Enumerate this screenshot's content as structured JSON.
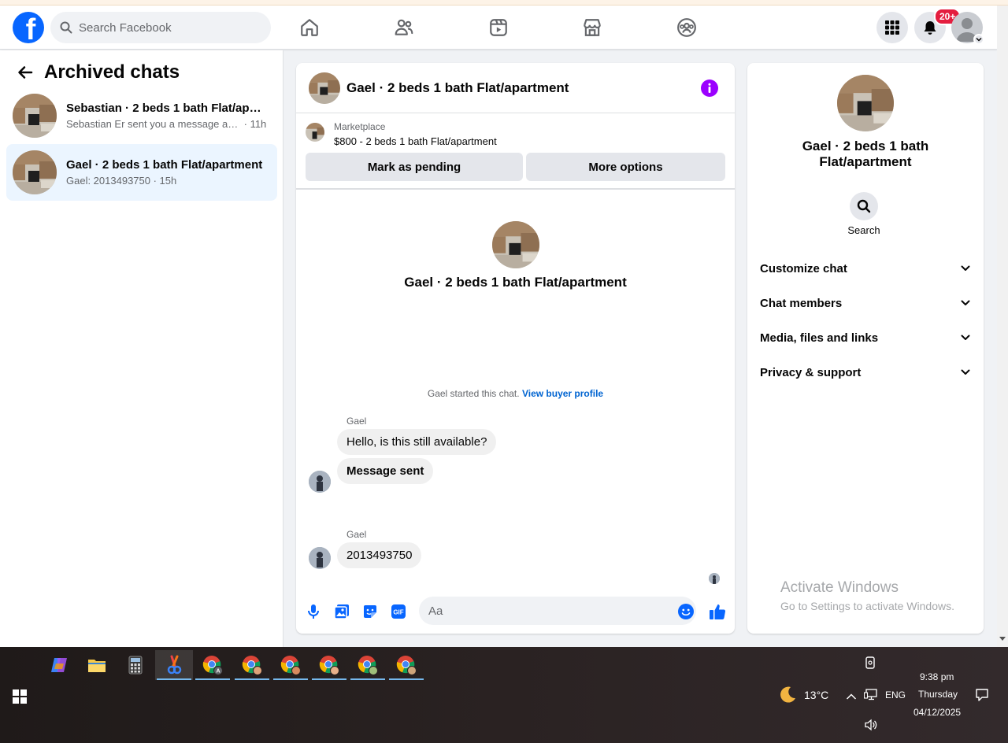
{
  "nav": {
    "search_placeholder": "Search Facebook",
    "notification_badge": "20+"
  },
  "sidebar": {
    "title": "Archived chats",
    "chats": [
      {
        "title": "Sebastian · 2 beds 1 bath Flat/apartment",
        "snippet": "Sebastian Er sent you a message abo...",
        "time": "11h"
      },
      {
        "title": "Gael · 2 beds 1 bath Flat/apartment",
        "snippet": "Gael: 2013493750",
        "time": "15h"
      }
    ]
  },
  "conversation": {
    "title": "Gael · 2 beds 1 bath Flat/apartment",
    "marketplace_label": "Marketplace",
    "listing": "$800 - 2 beds 1 bath Flat/apartment",
    "mark_pending": "Mark as pending",
    "more_options": "More options",
    "intro_title": "Gael · 2 beds 1 bath Flat/apartment",
    "started_text": "Gael started this chat.",
    "view_profile": "View buyer profile",
    "messages": [
      {
        "sender": "Gael",
        "text": "Hello, is this still available?"
      },
      {
        "text": "Message sent"
      },
      {
        "sender": "Gael",
        "text": "2013493750"
      }
    ],
    "composer_placeholder": "Aa"
  },
  "details": {
    "title": "Gael · 2 beds 1 bath Flat/apartment",
    "search_label": "Search",
    "sections": [
      "Customize chat",
      "Chat members",
      "Media, files and links",
      "Privacy & support"
    ]
  },
  "watermark": {
    "line1": "Activate Windows",
    "line2": "Go to Settings to activate Windows."
  },
  "taskbar": {
    "weather": "13°C",
    "language": "ENG",
    "time": "9:38 pm",
    "day": "Thursday",
    "date": "04/12/2025"
  },
  "colors": {
    "brand": "#0866ff",
    "accent_purple": "#9b00ff",
    "link": "#0064d1",
    "badge": "#e41e3f"
  }
}
